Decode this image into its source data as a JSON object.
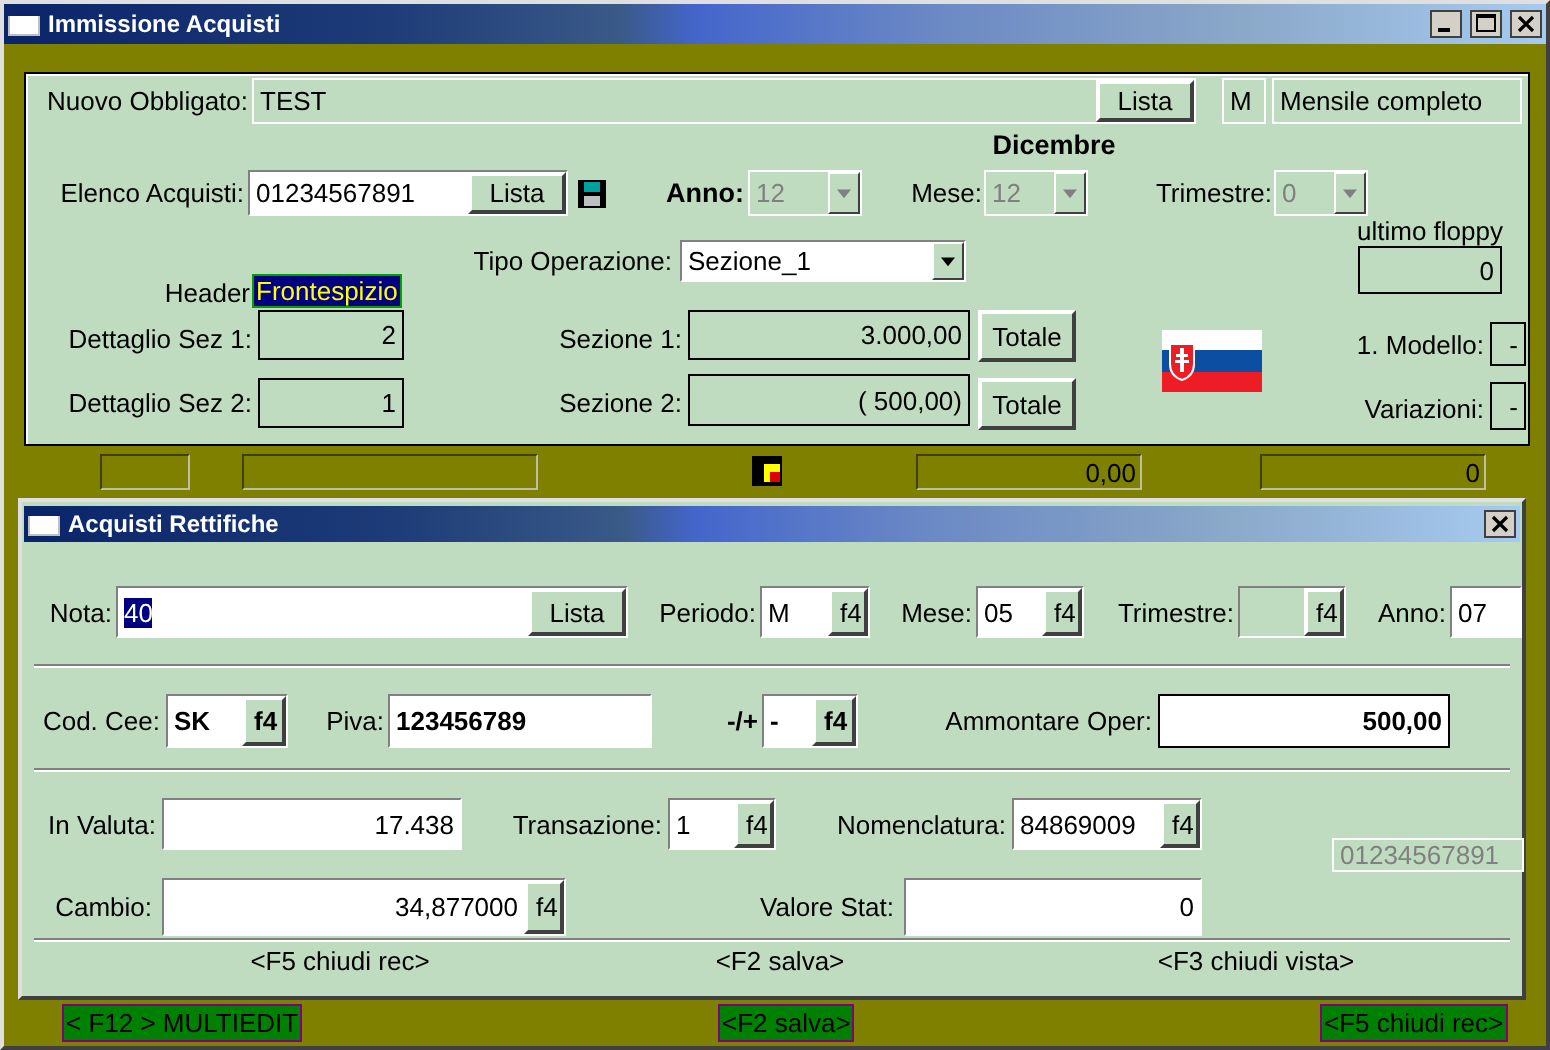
{
  "window": {
    "title": "Immissione  Acquisti"
  },
  "main": {
    "obbligato": {
      "label": "Nuovo Obbligato:",
      "value": "TEST",
      "button": "Lista"
    },
    "periodicity": {
      "code": "M",
      "description": "Mensile completo"
    },
    "month_name": "Dicembre",
    "elenco": {
      "label": "Elenco Acquisti:",
      "value": "01234567891",
      "button": "Lista"
    },
    "combos": [
      {
        "label": "Anno:",
        "value": "12",
        "disabled": true
      },
      {
        "label": "Mese:",
        "value": "12",
        "disabled": true
      },
      {
        "label": "Trimestre:",
        "value": "0",
        "disabled": true
      }
    ],
    "tipo": {
      "label": "Tipo Operazione:",
      "value": "Sezione_1",
      "disabled": false
    },
    "ultimo_floppy": {
      "label": "ultimo floppy",
      "value": "0"
    },
    "header": {
      "label": "Header",
      "value": "Frontespizio"
    },
    "dettagli": [
      {
        "label": "Dettaglio Sez 1:",
        "value": "2"
      },
      {
        "label": "Dettaglio Sez 2:",
        "value": "1"
      }
    ],
    "sezioni": [
      {
        "label": "Sezione 1:",
        "value": "3.000,00",
        "button": "Totale"
      },
      {
        "label": "Sezione 2:",
        "value": "( 500,00)",
        "button": "Totale"
      }
    ],
    "flags": [
      {
        "label": "1. Modello:",
        "value": "-"
      },
      {
        "label": "Variazioni:",
        "value": "-"
      }
    ]
  },
  "status_bar": {
    "total": "0,00",
    "count": "0"
  },
  "dialog": {
    "title": "Acquisti Rettifiche",
    "rows": [
      {
        "fields": [
          {
            "label": "Nota:",
            "value": "40",
            "button": "Lista",
            "text_selected": true
          },
          {
            "label": "Periodo:",
            "value": "M",
            "button": "f4"
          },
          {
            "label": "Mese:",
            "value": "05",
            "button": "f4"
          },
          {
            "label": "Trimestre:",
            "button": "f4",
            "disabled": true
          },
          {
            "label": "Anno:",
            "value": "07"
          }
        ]
      },
      {
        "fields": [
          {
            "label": "Cod. Cee:",
            "value": "SK",
            "button": "f4"
          },
          {
            "label": "Piva:",
            "value": "123456789"
          },
          {
            "label": "-/+",
            "value": "-",
            "button": "f4"
          },
          {
            "label": "Ammontare Oper:",
            "value": "500,00"
          }
        ]
      },
      {
        "fields": [
          {
            "label": "In Valuta:",
            "value": "17.438"
          },
          {
            "label": "Transazione:",
            "value": "1",
            "button": "f4"
          },
          {
            "label": "Nomenclatura:",
            "value": "84869009",
            "button": "f4"
          },
          {
            "value": "01234567891",
            "disabled": true
          }
        ]
      },
      {
        "fields": [
          {
            "label": "Cambio:",
            "value": "34,877000",
            "button": "f4"
          },
          {
            "label": "Valore Stat:",
            "value": "0"
          }
        ]
      }
    ],
    "shortcuts": [
      "<F5 chiudi rec>",
      "<F2 salva>",
      "<F3 chiudi vista>"
    ]
  },
  "bottom_bar": [
    "< F12 > MULTIEDIT",
    "<F2 salva>",
    "<F5 chiudi rec>"
  ]
}
